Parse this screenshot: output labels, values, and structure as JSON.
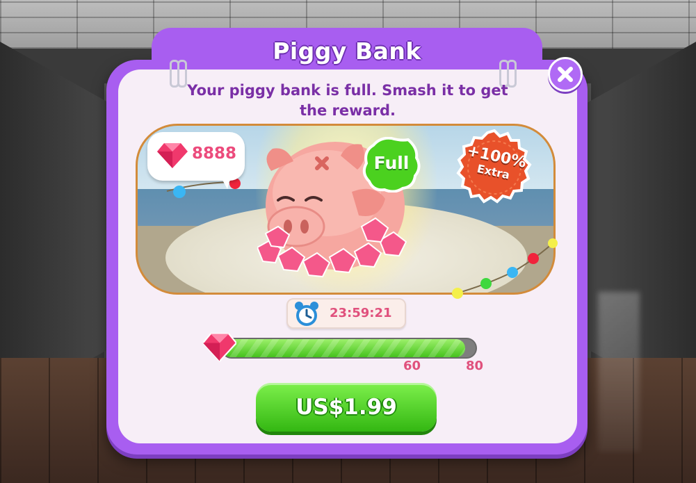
{
  "dialog": {
    "title": "Piggy Bank",
    "subtitle": "Your piggy bank is full. Smash it to get the reward."
  },
  "banner": {
    "gem_count": "8888",
    "status_badge": "Full",
    "bonus_badge": {
      "line1": "+100%",
      "line2": "Extra"
    }
  },
  "timer": {
    "value": "23:59:21"
  },
  "progress": {
    "fill_fraction": 0.96,
    "markers": [
      "60",
      "80"
    ]
  },
  "purchase": {
    "price_label": "US$1.99"
  },
  "colors": {
    "frame_purple": "#a85ef0",
    "text_purple": "#7a2fa6",
    "gem_pink": "#ec4b7c",
    "button_green": "#45c21d"
  },
  "icons": {
    "close": "close-icon",
    "gem": "gem-icon",
    "clock": "alarm-clock-icon",
    "piggy": "piggy-bank-icon"
  }
}
